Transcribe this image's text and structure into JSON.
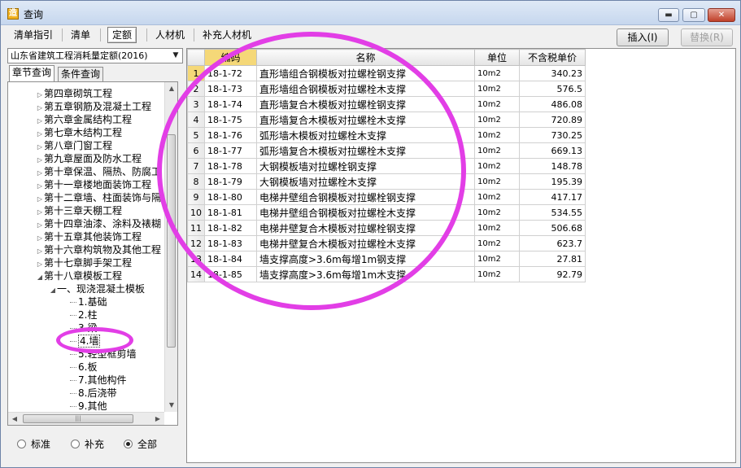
{
  "window": {
    "title": "查询",
    "icon": "app-icon"
  },
  "toolbar": {
    "tabs": [
      {
        "label": "清单指引",
        "active": false
      },
      {
        "label": "清单",
        "active": false
      },
      {
        "label": "定额",
        "active": true
      },
      {
        "label": "人材机",
        "active": false
      },
      {
        "label": "补充人材机",
        "active": false
      }
    ],
    "insert_label": "插入(I)",
    "replace_label": "替换(R)"
  },
  "left_panel": {
    "quota_library": "山东省建筑工程消耗量定额(2016)",
    "subtabs": [
      "章节查询",
      "条件查询"
    ],
    "tree": [
      {
        "label": "第四章砌筑工程",
        "level": 1,
        "state": "collapsed"
      },
      {
        "label": "第五章钢筋及混凝土工程",
        "level": 1,
        "state": "collapsed"
      },
      {
        "label": "第六章金属结构工程",
        "level": 1,
        "state": "collapsed"
      },
      {
        "label": "第七章木结构工程",
        "level": 1,
        "state": "collapsed"
      },
      {
        "label": "第八章门窗工程",
        "level": 1,
        "state": "collapsed"
      },
      {
        "label": "第九章屋面及防水工程",
        "level": 1,
        "state": "collapsed"
      },
      {
        "label": "第十章保温、隔热、防腐工",
        "level": 1,
        "state": "collapsed"
      },
      {
        "label": "第十一章楼地面装饰工程",
        "level": 1,
        "state": "collapsed"
      },
      {
        "label": "第十二章墙、柱面装饰与隔",
        "level": 1,
        "state": "collapsed"
      },
      {
        "label": "第十三章天棚工程",
        "level": 1,
        "state": "collapsed"
      },
      {
        "label": "第十四章油漆、涂料及裱糊",
        "level": 1,
        "state": "collapsed"
      },
      {
        "label": "第十五章其他装饰工程",
        "level": 1,
        "state": "collapsed"
      },
      {
        "label": "第十六章构筑物及其他工程",
        "level": 1,
        "state": "collapsed"
      },
      {
        "label": "第十七章脚手架工程",
        "level": 1,
        "state": "collapsed"
      },
      {
        "label": "第十八章模板工程",
        "level": 1,
        "state": "expanded"
      },
      {
        "label": "一、现浇混凝土模板",
        "level": 2,
        "state": "expanded"
      },
      {
        "label": "1.基础",
        "level": 3,
        "state": "leaf"
      },
      {
        "label": "2.柱",
        "level": 3,
        "state": "leaf"
      },
      {
        "label": "3.梁",
        "level": 3,
        "state": "leaf"
      },
      {
        "label": "4.墙",
        "level": 3,
        "state": "leaf",
        "selected": true
      },
      {
        "label": "5.轻型框剪墙",
        "level": 3,
        "state": "leaf"
      },
      {
        "label": "6.板",
        "level": 3,
        "state": "leaf"
      },
      {
        "label": "7.其他构件",
        "level": 3,
        "state": "leaf"
      },
      {
        "label": "8.后浇带",
        "level": 3,
        "state": "leaf"
      },
      {
        "label": "9.其他",
        "level": 3,
        "state": "leaf"
      }
    ],
    "radio_options": [
      {
        "label": "标准",
        "checked": false
      },
      {
        "label": "补充",
        "checked": false
      },
      {
        "label": "全部",
        "checked": true
      }
    ]
  },
  "grid": {
    "headers": [
      "",
      "编码",
      "名称",
      "单位",
      "不含税单价"
    ],
    "rows": [
      {
        "n": "1",
        "code": "18-1-72",
        "name": "直形墙组合钢模板对拉螺栓钢支撑",
        "unit": "10m2",
        "price": "340.23"
      },
      {
        "n": "2",
        "code": "18-1-73",
        "name": "直形墙组合钢模板对拉螺栓木支撑",
        "unit": "10m2",
        "price": "576.5"
      },
      {
        "n": "3",
        "code": "18-1-74",
        "name": "直形墙复合木模板对拉螺栓钢支撑",
        "unit": "10m2",
        "price": "486.08"
      },
      {
        "n": "4",
        "code": "18-1-75",
        "name": "直形墙复合木模板对拉螺栓木支撑",
        "unit": "10m2",
        "price": "720.89"
      },
      {
        "n": "5",
        "code": "18-1-76",
        "name": "弧形墙木模板对拉螺栓木支撑",
        "unit": "10m2",
        "price": "730.25"
      },
      {
        "n": "6",
        "code": "18-1-77",
        "name": "弧形墙复合木模板对拉螺栓木支撑",
        "unit": "10m2",
        "price": "669.13"
      },
      {
        "n": "7",
        "code": "18-1-78",
        "name": "大钢模板墙对拉螺栓钢支撑",
        "unit": "10m2",
        "price": "148.78"
      },
      {
        "n": "8",
        "code": "18-1-79",
        "name": "大钢模板墙对拉螺栓木支撑",
        "unit": "10m2",
        "price": "195.39"
      },
      {
        "n": "9",
        "code": "18-1-80",
        "name": "电梯井壁组合钢模板对拉螺栓钢支撑",
        "unit": "10m2",
        "price": "417.17"
      },
      {
        "n": "10",
        "code": "18-1-81",
        "name": "电梯井壁组合钢模板对拉螺栓木支撑",
        "unit": "10m2",
        "price": "534.55"
      },
      {
        "n": "11",
        "code": "18-1-82",
        "name": "电梯井壁复合木模板对拉螺栓钢支撑",
        "unit": "10m2",
        "price": "506.68"
      },
      {
        "n": "12",
        "code": "18-1-83",
        "name": "电梯井壁复合木模板对拉螺栓木支撑",
        "unit": "10m2",
        "price": "623.7"
      },
      {
        "n": "13",
        "code": "18-1-84",
        "name": "墙支撑高度>3.6m每增1m钢支撑",
        "unit": "10m2",
        "price": "27.81"
      },
      {
        "n": "14",
        "code": "18-1-85",
        "name": "墙支撑高度>3.6m每增1m木支撑",
        "unit": "10m2",
        "price": "92.79"
      }
    ]
  },
  "annotation_color": "#e23ee6"
}
